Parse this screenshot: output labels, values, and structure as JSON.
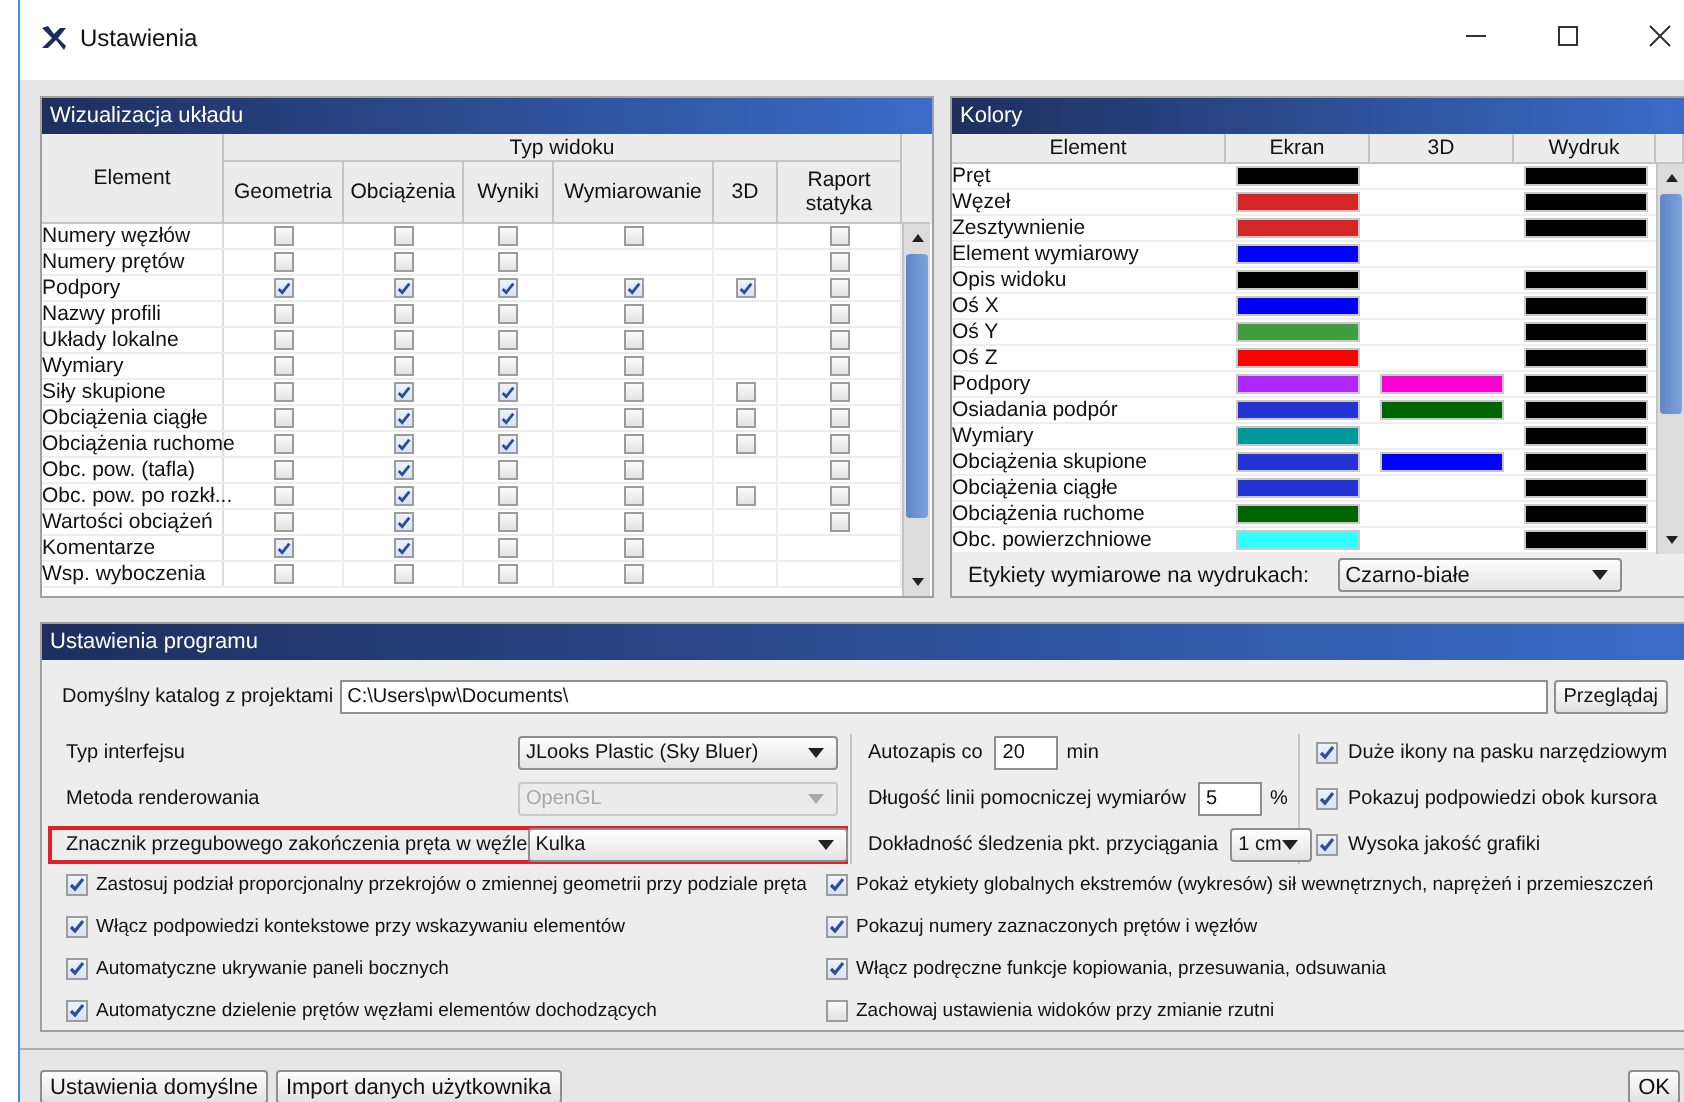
{
  "window": {
    "title": "Ustawienia"
  },
  "visualization": {
    "title": "Wizualizacja układu",
    "element_header": "Element",
    "group_header": "Typ widoku",
    "columns": [
      "Geometria",
      "Obciążenia",
      "Wyniki",
      "Wymiarowanie",
      "3D",
      "Raport statyka"
    ],
    "rows": [
      {
        "name": "Numery węzłów",
        "checks": [
          {
            "kind": "checkbox",
            "checked": false
          },
          {
            "kind": "checkbox",
            "checked": false
          },
          {
            "kind": "checkbox",
            "checked": false
          },
          {
            "kind": "checkbox",
            "checked": false
          },
          {
            "kind": "blank"
          },
          {
            "kind": "checkbox",
            "checked": false
          }
        ]
      },
      {
        "name": "Numery prętów",
        "checks": [
          {
            "kind": "checkbox",
            "checked": false
          },
          {
            "kind": "checkbox",
            "checked": false
          },
          {
            "kind": "checkbox",
            "checked": false
          },
          {
            "kind": "blank"
          },
          {
            "kind": "blank"
          },
          {
            "kind": "checkbox",
            "checked": false
          }
        ]
      },
      {
        "name": "Podpory",
        "checks": [
          {
            "kind": "checkbox",
            "checked": true
          },
          {
            "kind": "checkbox",
            "checked": true
          },
          {
            "kind": "checkbox",
            "checked": true
          },
          {
            "kind": "checkbox",
            "checked": true
          },
          {
            "kind": "checkbox",
            "checked": true
          },
          {
            "kind": "checkbox",
            "checked": false
          }
        ]
      },
      {
        "name": "Nazwy profili",
        "checks": [
          {
            "kind": "checkbox",
            "checked": false
          },
          {
            "kind": "checkbox",
            "checked": false
          },
          {
            "kind": "checkbox",
            "checked": false
          },
          {
            "kind": "checkbox",
            "checked": false
          },
          {
            "kind": "blank"
          },
          {
            "kind": "checkbox",
            "checked": false
          }
        ]
      },
      {
        "name": "Układy lokalne",
        "checks": [
          {
            "kind": "checkbox",
            "checked": false
          },
          {
            "kind": "checkbox",
            "checked": false
          },
          {
            "kind": "checkbox",
            "checked": false
          },
          {
            "kind": "checkbox",
            "checked": false
          },
          {
            "kind": "blank"
          },
          {
            "kind": "checkbox",
            "checked": false
          }
        ]
      },
      {
        "name": "Wymiary",
        "checks": [
          {
            "kind": "checkbox",
            "checked": false
          },
          {
            "kind": "checkbox",
            "checked": false
          },
          {
            "kind": "checkbox",
            "checked": false
          },
          {
            "kind": "checkbox",
            "checked": false
          },
          {
            "kind": "blank"
          },
          {
            "kind": "checkbox",
            "checked": false
          }
        ]
      },
      {
        "name": "Siły skupione",
        "checks": [
          {
            "kind": "checkbox",
            "checked": false
          },
          {
            "kind": "checkbox",
            "checked": true
          },
          {
            "kind": "checkbox",
            "checked": true
          },
          {
            "kind": "checkbox",
            "checked": false
          },
          {
            "kind": "checkbox",
            "checked": false
          },
          {
            "kind": "checkbox",
            "checked": false
          }
        ]
      },
      {
        "name": "Obciążenia ciągłe",
        "checks": [
          {
            "kind": "checkbox",
            "checked": false
          },
          {
            "kind": "checkbox",
            "checked": true
          },
          {
            "kind": "checkbox",
            "checked": true
          },
          {
            "kind": "checkbox",
            "checked": false
          },
          {
            "kind": "checkbox",
            "checked": false
          },
          {
            "kind": "checkbox",
            "checked": false
          }
        ]
      },
      {
        "name": "Obciążenia ruchome",
        "checks": [
          {
            "kind": "checkbox",
            "checked": false
          },
          {
            "kind": "checkbox",
            "checked": true
          },
          {
            "kind": "checkbox",
            "checked": true
          },
          {
            "kind": "checkbox",
            "checked": false
          },
          {
            "kind": "checkbox",
            "checked": false
          },
          {
            "kind": "checkbox",
            "checked": false
          }
        ]
      },
      {
        "name": "Obc. pow. (tafla)",
        "checks": [
          {
            "kind": "checkbox",
            "checked": false
          },
          {
            "kind": "checkbox",
            "checked": true
          },
          {
            "kind": "checkbox",
            "checked": false
          },
          {
            "kind": "checkbox",
            "checked": false
          },
          {
            "kind": "blank"
          },
          {
            "kind": "checkbox",
            "checked": false
          }
        ]
      },
      {
        "name": "Obc. pow. po rozkł...",
        "checks": [
          {
            "kind": "checkbox",
            "checked": false
          },
          {
            "kind": "checkbox",
            "checked": true
          },
          {
            "kind": "checkbox",
            "checked": false
          },
          {
            "kind": "checkbox",
            "checked": false
          },
          {
            "kind": "checkbox",
            "checked": false
          },
          {
            "kind": "checkbox",
            "checked": false
          }
        ]
      },
      {
        "name": "Wartości obciążeń",
        "checks": [
          {
            "kind": "checkbox",
            "checked": false
          },
          {
            "kind": "checkbox",
            "checked": true
          },
          {
            "kind": "checkbox",
            "checked": false
          },
          {
            "kind": "checkbox",
            "checked": false
          },
          {
            "kind": "blank"
          },
          {
            "kind": "checkbox",
            "checked": false
          }
        ]
      },
      {
        "name": "Komentarze",
        "checks": [
          {
            "kind": "checkbox",
            "checked": true
          },
          {
            "kind": "checkbox",
            "checked": true
          },
          {
            "kind": "checkbox",
            "checked": false
          },
          {
            "kind": "checkbox",
            "checked": false
          },
          {
            "kind": "blank"
          },
          {
            "kind": "blank"
          }
        ]
      },
      {
        "name": "Wsp. wyboczenia",
        "checks": [
          {
            "kind": "checkbox",
            "checked": false
          },
          {
            "kind": "checkbox",
            "checked": false
          },
          {
            "kind": "checkbox",
            "checked": false
          },
          {
            "kind": "checkbox",
            "checked": false
          },
          {
            "kind": "blank"
          },
          {
            "kind": "blank"
          }
        ]
      }
    ]
  },
  "colors": {
    "title": "Kolory",
    "columns": [
      "Element",
      "Ekran",
      "3D",
      "Wydruk"
    ],
    "rows": [
      {
        "name": "Pręt",
        "screen": {
          "color": "#000000"
        },
        "print": {
          "color": "#000000"
        }
      },
      {
        "name": "Węzeł",
        "screen": {
          "color": "#d42626"
        },
        "print": {
          "color": "#000000"
        }
      },
      {
        "name": "Zesztywnienie",
        "screen": {
          "color": "#d42626"
        },
        "print": {
          "color": "#000000"
        }
      },
      {
        "name": "Element wymiarowy",
        "screen": {
          "color": "#0000ff"
        }
      },
      {
        "name": "Opis widoku",
        "screen": {
          "color": "#000000"
        },
        "print": {
          "color": "#000000"
        }
      },
      {
        "name": "Oś X",
        "screen": {
          "color": "#0000ff"
        },
        "print": {
          "color": "#000000"
        }
      },
      {
        "name": "Oś Y",
        "screen": {
          "color": "#409e40"
        },
        "print": {
          "color": "#000000"
        }
      },
      {
        "name": "Oś Z",
        "screen": {
          "color": "#ff0000"
        },
        "print": {
          "color": "#000000"
        }
      },
      {
        "name": "Podpory",
        "screen": {
          "color": "#b026ff"
        },
        "view_3d": {
          "color": "#ff00d4"
        },
        "print": {
          "color": "#000000"
        }
      },
      {
        "name": "Osiadania podpór",
        "screen": {
          "color": "#2433d4"
        },
        "view_3d": {
          "color": "#006400"
        },
        "print": {
          "color": "#000000"
        }
      },
      {
        "name": "Wymiary",
        "screen": {
          "color": "#009999"
        },
        "print": {
          "color": "#000000"
        }
      },
      {
        "name": "Obciążenia skupione",
        "screen": {
          "color": "#2433d4"
        },
        "view_3d": {
          "color": "#0000ff"
        },
        "print": {
          "color": "#000000"
        }
      },
      {
        "name": "Obciążenia ciągłe",
        "screen": {
          "color": "#2433d4"
        },
        "print": {
          "color": "#000000"
        }
      },
      {
        "name": "Obciążenia ruchome",
        "screen": {
          "color": "#006400"
        },
        "print": {
          "color": "#000000"
        }
      },
      {
        "name": "Obc. powierzchniowe",
        "screen": {
          "color": "#33ffff"
        },
        "print": {
          "color": "#000000"
        }
      }
    ],
    "print_labels": {
      "label": "Etykiety wymiarowe na wydrukach:",
      "value": "Czarno-białe"
    }
  },
  "program_settings": {
    "title": "Ustawienia programu",
    "project_dir": {
      "label": "Domyślny katalog z projektami",
      "value": "C:\\Users\\pw\\Documents\\",
      "button": "Przeglądaj"
    },
    "selects": [
      {
        "label": "Typ interfejsu",
        "value": "JLooks Plastic (Sky Bluer)",
        "disabled": false,
        "highlighted": false
      },
      {
        "label": "Metoda renderowania",
        "value": "OpenGL",
        "disabled": true,
        "highlighted": false
      },
      {
        "label": "Znacznik przegubowego zakończenia pręta w węźle",
        "value": "Kulka",
        "disabled": false,
        "highlighted": true
      }
    ],
    "middle": [
      {
        "kind": "input",
        "label": "Autozapis co",
        "value": "20",
        "unit": "min"
      },
      {
        "kind": "input",
        "label": "Długość linii pomocniczej wymiarów",
        "value": "5",
        "unit": "%"
      },
      {
        "kind": "select",
        "label": "Dokładność śledzenia pkt. przyciągania",
        "value": "1 cm"
      }
    ],
    "right_checks": [
      {
        "label": "Duże ikony na pasku narzędziowym",
        "checked": true
      },
      {
        "label": "Pokazuj podpowiedzi obok kursora",
        "checked": true
      },
      {
        "label": "Wysoka jakość grafiki",
        "checked": true
      }
    ],
    "checks_left": [
      {
        "label": "Zastosuj podział proporcjonalny przekrojów o zmiennej geometrii przy podziale pręta",
        "checked": true
      },
      {
        "label": "Włącz podpowiedzi kontekstowe przy wskazywaniu elementów",
        "checked": true
      },
      {
        "label": "Automatyczne ukrywanie paneli bocznych",
        "checked": true
      },
      {
        "label": "Automatyczne dzielenie prętów węzłami elementów dochodzących",
        "checked": true
      }
    ],
    "checks_right": [
      {
        "label": "Pokaż etykiety globalnych ekstremów (wykresów) sił wewnętrznych, naprężeń i przemieszczeń",
        "checked": true
      },
      {
        "label": "Pokazuj numery zaznaczonych prętów i węzłów",
        "checked": true
      },
      {
        "label": "Włącz podręczne funkcje kopiowania, przesuwania, odsuwania",
        "checked": true
      },
      {
        "label": "Zachowaj ustawienia widoków przy zmianie rzutni",
        "checked": false
      }
    ]
  },
  "footer_buttons": [
    "Ustawienia domyślne",
    "Import danych użytkownika"
  ],
  "ok_button": "OK"
}
